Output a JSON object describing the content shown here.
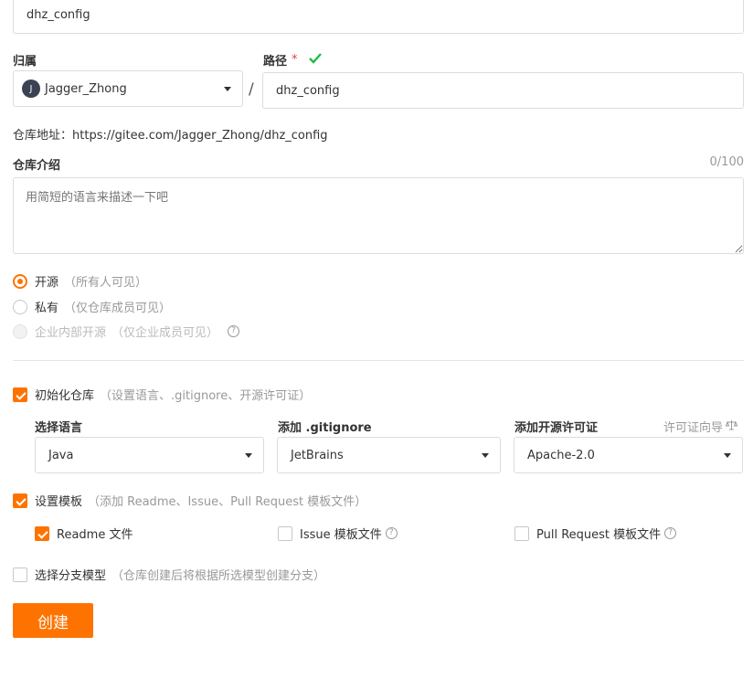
{
  "repo_name": {
    "value": "dhz_config"
  },
  "owner": {
    "label": "归属",
    "avatar_letter": "J",
    "value": "Jagger_Zhong"
  },
  "path": {
    "label": "路径",
    "required_mark": "*",
    "value": "dhz_config",
    "separator": "/"
  },
  "address": {
    "label": "仓库地址：",
    "url": "https://gitee.com/Jagger_Zhong/dhz_config"
  },
  "description": {
    "label": "仓库介绍",
    "counter": "0/100",
    "placeholder": "用简短的语言来描述一下吧"
  },
  "visibility": {
    "options": [
      {
        "label": "开源",
        "hint": "（所有人可见）",
        "selected": true
      },
      {
        "label": "私有",
        "hint": "（仅仓库成员可见）",
        "selected": false
      },
      {
        "label": "企业内部开源",
        "hint": "（仅企业成员可见）",
        "selected": false,
        "disabled": true
      }
    ]
  },
  "init": {
    "label": "初始化仓库",
    "hint": "（设置语言、.gitignore、开源许可证）",
    "checked": true,
    "language": {
      "label": "选择语言",
      "value": "Java"
    },
    "gitignore": {
      "label": "添加 .gitignore",
      "value": "JetBrains"
    },
    "license": {
      "label": "添加开源许可证",
      "value": "Apache-2.0",
      "guide_link": "许可证向导"
    }
  },
  "templates": {
    "label": "设置模板",
    "hint": "（添加 Readme、Issue、Pull Request 模板文件）",
    "checked": true,
    "readme": {
      "label": "Readme 文件",
      "checked": true
    },
    "issue": {
      "label": "Issue 模板文件",
      "checked": false
    },
    "pr": {
      "label": "Pull Request 模板文件",
      "checked": false
    }
  },
  "branch_model": {
    "label": "选择分支模型",
    "hint": "（仓库创建后将根据所选模型创建分支）",
    "checked": false
  },
  "create_button": {
    "label": "创建"
  },
  "colors": {
    "accent": "#fe7300",
    "valid": "#21ba45"
  }
}
